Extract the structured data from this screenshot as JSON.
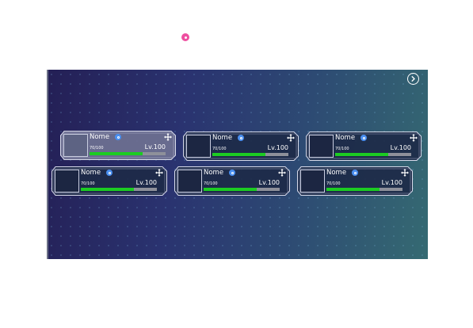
{
  "next_button_icon": "chevron-right-circle-icon",
  "pin_icon": "pin-icon",
  "colors": {
    "hp_bar": "#1ccc22",
    "bar_empty": "#8e909a",
    "gender": "#4a8ff0",
    "pin": "#ee4fa0"
  },
  "party": [
    {
      "name": "Nome",
      "hp_text": "70/100",
      "hp_fraction": 0.7,
      "level": "Lv.100",
      "gender_icon": "male-icon",
      "selected": true
    },
    {
      "name": "Nome",
      "hp_text": "70/100",
      "hp_fraction": 0.7,
      "level": "Lv.100",
      "gender_icon": "male-icon",
      "selected": false
    },
    {
      "name": "Nome",
      "hp_text": "70/100",
      "hp_fraction": 0.7,
      "level": "Lv.100",
      "gender_icon": "male-icon",
      "selected": false
    },
    {
      "name": "Nome",
      "hp_text": "70/100",
      "hp_fraction": 0.7,
      "level": "Lv.100",
      "gender_icon": "male-icon",
      "selected": false
    },
    {
      "name": "Nome",
      "hp_text": "70/100",
      "hp_fraction": 0.7,
      "level": "Lv.100",
      "gender_icon": "male-icon",
      "selected": false
    },
    {
      "name": "Nome",
      "hp_text": "70/100",
      "hp_fraction": 0.7,
      "level": "Lv.100",
      "gender_icon": "male-icon",
      "selected": false
    }
  ]
}
